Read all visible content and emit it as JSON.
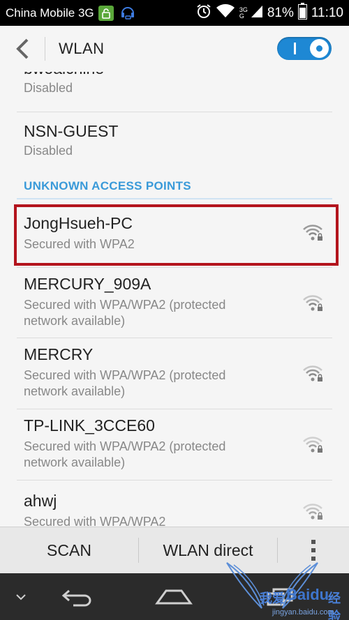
{
  "status_bar": {
    "carrier": "China Mobile 3G",
    "network_top": "3G",
    "network_bottom": "G",
    "battery": "81%",
    "time": "11:10"
  },
  "action_bar": {
    "title": "WLAN",
    "toggle_state": "on"
  },
  "networks_saved": [
    {
      "ssid": "bwoaichine",
      "status": "Disabled"
    },
    {
      "ssid": "NSN-GUEST",
      "status": "Disabled"
    }
  ],
  "section_header": "UNKNOWN ACCESS POINTS",
  "networks_unknown": [
    {
      "ssid": "JongHsueh-PC",
      "status_line1": "Secured with WPA2",
      "status_line2": ""
    },
    {
      "ssid": "MERCURY_909A",
      "status_line1": "Secured with WPA/WPA2 (protected",
      "status_line2": "network available)"
    },
    {
      "ssid": "MERCRY",
      "status_line1": "Secured with WPA/WPA2 (protected",
      "status_line2": "network available)"
    },
    {
      "ssid": "TP-LINK_3CCE60",
      "status_line1": "Secured with WPA/WPA2 (protected",
      "status_line2": "network available)"
    },
    {
      "ssid": "ahwj",
      "status_line1": "Secured with WPA/WPA2",
      "status_line2": ""
    }
  ],
  "toolbar": {
    "scan_label": "SCAN",
    "direct_label": "WLAN direct"
  },
  "watermark": {
    "brand_cn": "我爱",
    "brand": "Baidu",
    "brand_suffix": "经验",
    "url": "jingyan.baidu.com"
  },
  "colors": {
    "accent": "#1e88d4",
    "section_header": "#3a9ad9",
    "highlight": "#b3141d"
  }
}
